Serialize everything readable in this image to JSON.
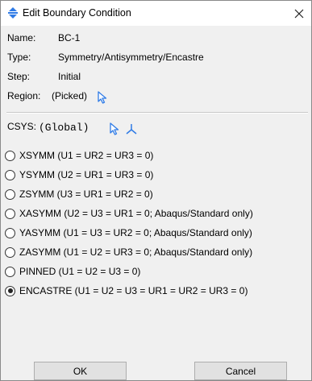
{
  "window": {
    "title": "Edit Boundary Condition"
  },
  "fields": {
    "name_label": "Name:",
    "name_value": "BC-1",
    "type_label": "Type:",
    "type_value": "Symmetry/Antisymmetry/Encastre",
    "step_label": "Step:",
    "step_value": "Initial",
    "region_label": "Region:",
    "region_value": "(Picked)"
  },
  "csys": {
    "label": "CSYS:",
    "value": "(Global)"
  },
  "options": [
    {
      "label": "XSYMM (U1 = UR2 = UR3 = 0)",
      "selected": false
    },
    {
      "label": "YSYMM (U2 = UR1 = UR3 = 0)",
      "selected": false
    },
    {
      "label": "ZSYMM (U3 = UR1 = UR2 = 0)",
      "selected": false
    },
    {
      "label": "XASYMM (U2 = U3 = UR1 = 0; Abaqus/Standard only)",
      "selected": false
    },
    {
      "label": "YASYMM (U1 = U3 = UR2 = 0; Abaqus/Standard only)",
      "selected": false
    },
    {
      "label": "ZASYMM (U1 = U2 = UR3 = 0; Abaqus/Standard only)",
      "selected": false
    },
    {
      "label": "PINNED (U1 = U2 = U3 = 0)",
      "selected": false
    },
    {
      "label": "ENCASTRE (U1 = U2 = U3 = UR1 = UR2 = UR3 = 0)",
      "selected": true
    }
  ],
  "buttons": {
    "ok": "OK",
    "cancel": "Cancel"
  },
  "colors": {
    "accent": "#1e6fd9",
    "pick_arrow": "#2f7be6"
  }
}
